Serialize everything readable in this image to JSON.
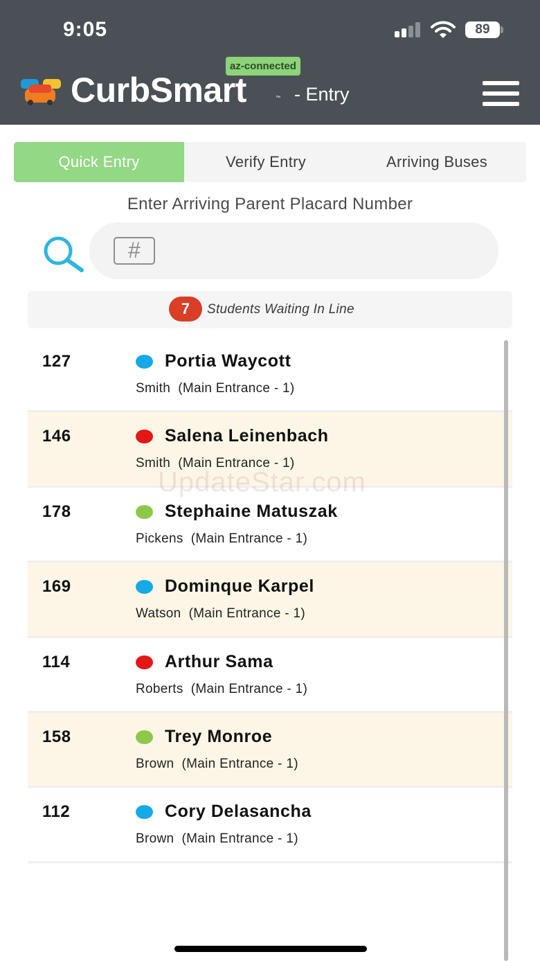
{
  "status_bar": {
    "time": "9:05",
    "battery": "89"
  },
  "header": {
    "brand": "CurbSmart",
    "trademark": "™",
    "subtitle": "- Entry",
    "connection_badge": "az-connected"
  },
  "tabs": [
    {
      "label": "Quick Entry",
      "active": true
    },
    {
      "label": "Verify Entry",
      "active": false
    },
    {
      "label": "Arriving Buses",
      "active": false
    }
  ],
  "search": {
    "prompt": "Enter Arriving Parent Placard Number",
    "field_icon": "#",
    "value": ""
  },
  "waiting": {
    "count": "7",
    "label": "Students Waiting In Line"
  },
  "students": [
    {
      "number": "127",
      "name": "Portia Waycott",
      "teacher": "Smith  (Main Entrance - 1)",
      "dot_color": "#16a9e8"
    },
    {
      "number": "146",
      "name": "Salena Leinenbach",
      "teacher": "Smith  (Main Entrance - 1)",
      "dot_color": "#e41717"
    },
    {
      "number": "178",
      "name": "Stephaine Matuszak",
      "teacher": "Pickens  (Main Entrance - 1)",
      "dot_color": "#8cc94a"
    },
    {
      "number": "169",
      "name": "Dominque Karpel",
      "teacher": "Watson  (Main Entrance - 1)",
      "dot_color": "#16a9e8"
    },
    {
      "number": "114",
      "name": "Arthur Sama",
      "teacher": "Roberts  (Main Entrance - 1)",
      "dot_color": "#e41717"
    },
    {
      "number": "158",
      "name": "Trey Monroe",
      "teacher": "Brown  (Main Entrance - 1)",
      "dot_color": "#8cc94a"
    },
    {
      "number": "112",
      "name": "Cory Delasancha",
      "teacher": "Brown  (Main Entrance - 1)",
      "dot_color": "#16a9e8"
    }
  ],
  "watermark": "UpdateStar.com",
  "colors": {
    "header_bg": "#4b5056",
    "active_tab": "#93d885",
    "alt_row": "#fdf6e6",
    "badge": "#d93e26"
  }
}
